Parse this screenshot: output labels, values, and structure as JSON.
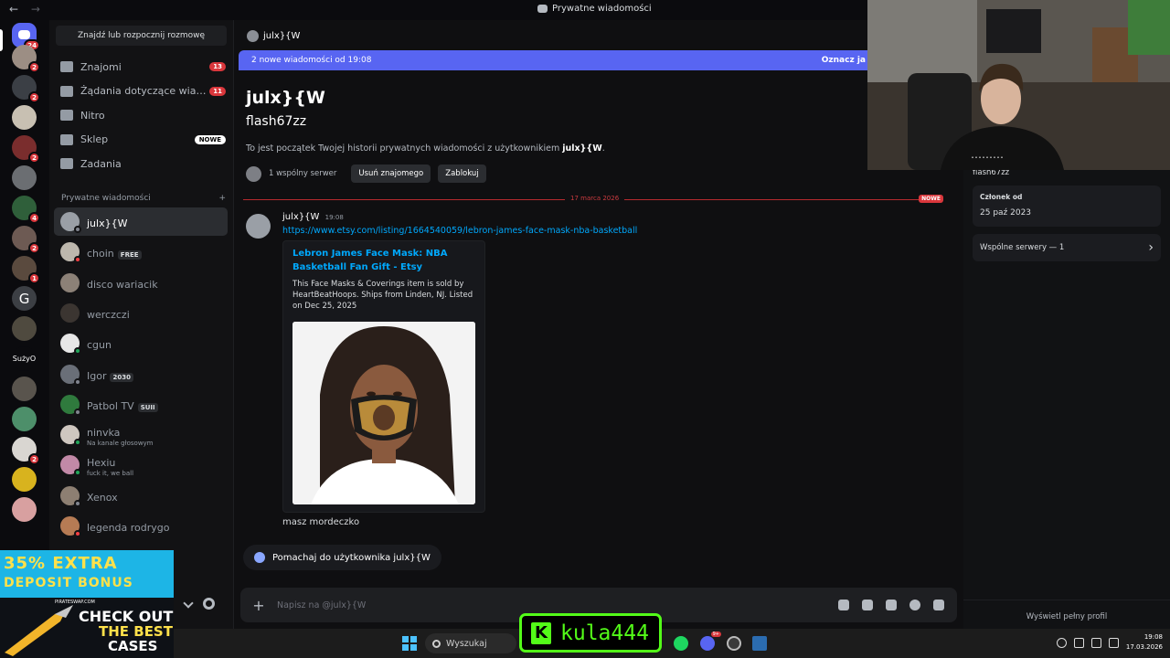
{
  "window": {
    "title": "Prywatne wiadomości",
    "back": "←",
    "forward": "→"
  },
  "rail": {
    "home_badge": "24",
    "servers": [
      {
        "badge": "2",
        "color": "#9c8e84"
      },
      {
        "badge": "2",
        "color": "#3b3f45"
      },
      {
        "badge": "",
        "color": "#c8c0b2"
      },
      {
        "badge": "2",
        "color": "#7a2d2d"
      },
      {
        "badge": "",
        "color": "#6b6e72"
      },
      {
        "badge": "4",
        "color": "#2f5f3a"
      },
      {
        "badge": "2",
        "color": "#6d5a53"
      },
      {
        "badge": "1",
        "color": "#5a4a3e"
      },
      {
        "badge": "",
        "color": "#3c3f44",
        "glyph": "G"
      },
      {
        "badge": "",
        "color": "#4f4a3f"
      },
      {
        "badge": "",
        "color": "#0b0b0e",
        "glyph": "SużyO"
      },
      {
        "badge": "",
        "color": "#59544d"
      },
      {
        "badge": "",
        "color": "#4d8f6a"
      },
      {
        "badge": "2",
        "color": "#d9d6d1"
      },
      {
        "badge": "",
        "color": "#d8b31e"
      },
      {
        "badge": "",
        "color": "#d8a0a0"
      }
    ]
  },
  "sidebar": {
    "find_button": "Znajdź lub rozpocznij rozmowę",
    "nav": [
      {
        "label": "Znajomi",
        "count": "13"
      },
      {
        "label": "Żądania dotyczące wiadomości",
        "count": "11"
      },
      {
        "label": "Nitro",
        "count": ""
      },
      {
        "label": "Sklep",
        "badge": "NOWE"
      },
      {
        "label": "Zadania",
        "count": ""
      }
    ],
    "section_title": "Prywatne wiadomości",
    "section_add": "+",
    "dms": [
      {
        "name": "julx}{W",
        "sub": "",
        "tag": "",
        "color": "#9a9fa6",
        "status": "#80848e"
      },
      {
        "name": "choin",
        "sub": "",
        "tag": "FREE",
        "color": "#bdb7ad",
        "status": "#f23f43"
      },
      {
        "name": "disco wariacik",
        "sub": "",
        "tag": "",
        "color": "#8c8177",
        "status": ""
      },
      {
        "name": "werczczi",
        "sub": "",
        "tag": "",
        "color": "#3b3531",
        "status": ""
      },
      {
        "name": "cgun",
        "sub": "",
        "tag": "",
        "color": "#e7e7e7",
        "status": "#23a55a"
      },
      {
        "name": "Igor",
        "sub": "",
        "tag": "2030",
        "color": "#6a6f78",
        "status": "#80848e"
      },
      {
        "name": "Patbol TV",
        "sub": "",
        "tag": "SUII",
        "color": "#2f7a3d",
        "status": "#80848e"
      },
      {
        "name": "ninvka",
        "sub": "Na kanale głosowym",
        "tag": "",
        "color": "#cfc7c0",
        "status": "#23a55a"
      },
      {
        "name": "Hexiu",
        "sub": "fuck it, we ball",
        "tag": "",
        "color": "#c289a7",
        "status": "#23a55a"
      },
      {
        "name": "Xenox",
        "sub": "",
        "tag": "",
        "color": "#8d7f72",
        "status": "#80848e"
      },
      {
        "name": "legenda rodrygo",
        "sub": "",
        "tag": "",
        "color": "#b67b54",
        "status": "#f23f43"
      }
    ]
  },
  "main": {
    "header_name": "julx}{W",
    "new_bar": "2 nowe wiadomości od 19:08",
    "new_bar_mark": "Oznacz ja",
    "big_name": "julx}{W",
    "username": "flash67zz",
    "intro_prefix": "To jest początek Twojej historii prywatnych wiadomości z użytkownikiem",
    "intro_name": "julx}{W",
    "intro_suffix": ".",
    "mutual": "1 wspólny serwer",
    "remove_friend": "Usuń znajomego",
    "block": "Zablokuj",
    "date_divider": "17 marca 2026",
    "new_label": "NOWE",
    "message": {
      "author": "julx}{W",
      "time": "19:08",
      "link": "https://www.etsy.com/listing/1664540059/lebron-james-face-mask-nba-basketball",
      "embed_title": "Lebron James Face Mask: NBA Basketball Fan Gift - Etsy",
      "embed_desc": "This Face Masks & Coverings item is sold by HeartBeatHoops. Ships from Linden, NJ. Listed on Dec 25, 2025",
      "text": "masz mordeczko"
    },
    "wave": "Pomachaj do użytkownika julx}{W",
    "composer_placeholder": "Napisz na @julx}{W",
    "composer_plus": "+"
  },
  "profile": {
    "handle": "flash67zz",
    "member_since_label": "Członek od",
    "member_since": "25 paź 2023",
    "mutual_servers": "Wspólne serwery — 1",
    "chevron": "›",
    "full_profile": "Wyświetl pełny profil"
  },
  "ad": {
    "line1": "35% EXTRA",
    "line2": "DEPOSIT BONUS",
    "brand": "PIRATESWAP.COM",
    "cta1": "CHECK OUT",
    "cta2": "THE BEST",
    "cta3": "CASES"
  },
  "overlay": {
    "kick_letter": "K",
    "kick_name": "kula444"
  },
  "taskbar": {
    "search": "Wyszukaj",
    "time": "19:08",
    "date": "17.03.2026",
    "badge": "9+"
  }
}
